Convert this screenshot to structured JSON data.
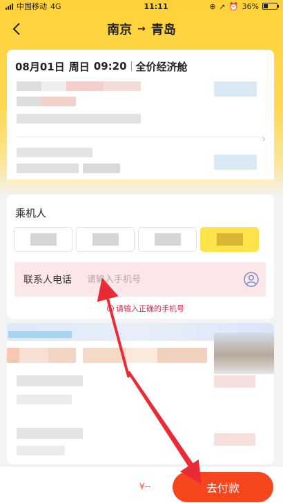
{
  "status_bar": {
    "carrier": "中国移动",
    "network": "4G",
    "time": "11:11",
    "battery": "36%",
    "battery_level": 0.36
  },
  "nav": {
    "from": "南京",
    "arrow": "→",
    "to": "青岛"
  },
  "flight": {
    "date": "08月01日",
    "weekday": "周日",
    "time": "09:20",
    "cabin": "全价经济舱"
  },
  "passengers": {
    "title": "乘机人"
  },
  "contact": {
    "label": "联系人电话",
    "placeholder": "请输入手机号",
    "value": "",
    "error": "请输入正确的手机号"
  },
  "bottom": {
    "price_prefix": "¥--",
    "pay_label": "去付款"
  },
  "colors": {
    "header_yellow": "#ffd23a",
    "accent_orange": "#f6461e",
    "error_red": "#d8284b",
    "chip_selected": "#ffe34a"
  }
}
